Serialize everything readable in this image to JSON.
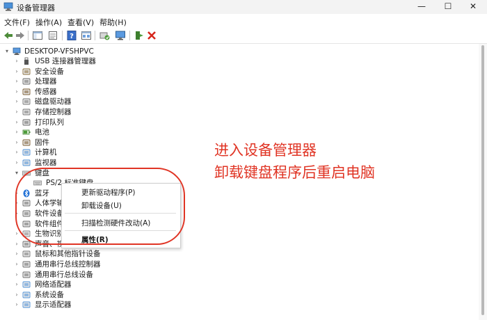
{
  "window": {
    "title": "设备管理器",
    "minimize": "—",
    "maximize": "☐",
    "close": "✕"
  },
  "menu": [
    "文件(F)",
    "操作(A)",
    "查看(V)",
    "帮助(H)"
  ],
  "toolbar_icons": [
    "back-arrow-icon",
    "forward-arrow-icon",
    "show-hide-console-tree-icon",
    "properties-icon",
    "help-icon",
    "view-icon",
    "update-driver-icon",
    "monitor-icon",
    "enable-device-icon",
    "uninstall-device-icon"
  ],
  "tree": {
    "root": "DESKTOP-VFSHPVC",
    "items": [
      {
        "label": "USB 连接器管理器",
        "icon": "usb-connector-icon"
      },
      {
        "label": "安全设备",
        "icon": "security-device-icon"
      },
      {
        "label": "处理器",
        "icon": "processor-icon"
      },
      {
        "label": "传感器",
        "icon": "sensor-icon"
      },
      {
        "label": "磁盘驱动器",
        "icon": "disk-drive-icon"
      },
      {
        "label": "存储控制器",
        "icon": "storage-controller-icon"
      },
      {
        "label": "打印队列",
        "icon": "print-queue-icon"
      },
      {
        "label": "电池",
        "icon": "battery-icon"
      },
      {
        "label": "固件",
        "icon": "firmware-icon"
      },
      {
        "label": "计算机",
        "icon": "computer-icon"
      },
      {
        "label": "监视器",
        "icon": "monitor-icon"
      },
      {
        "label": "键盘",
        "icon": "keyboard-icon"
      },
      {
        "label": "PS/2 标准键盘",
        "icon": "keyboard-icon"
      },
      {
        "label": "蓝牙",
        "icon": "bluetooth-icon"
      },
      {
        "label": "人体学输",
        "icon": "hid-icon"
      },
      {
        "label": "软件设备",
        "icon": "software-device-icon"
      },
      {
        "label": "软件组件",
        "icon": "software-component-icon"
      },
      {
        "label": "生物识别",
        "icon": "biometric-icon"
      },
      {
        "label": "声音、视",
        "icon": "audio-icon"
      },
      {
        "label": "鼠标和其他指针设备",
        "icon": "mouse-icon"
      },
      {
        "label": "通用串行总线控制器",
        "icon": "usb-controller-icon"
      },
      {
        "label": "通用串行总线设备",
        "icon": "usb-device-icon"
      },
      {
        "label": "网络适配器",
        "icon": "network-adapter-icon"
      },
      {
        "label": "系统设备",
        "icon": "system-device-icon"
      },
      {
        "label": "显示适配器",
        "icon": "display-adapter-icon"
      }
    ]
  },
  "context_menu": {
    "update_driver": "更新驱动程序(P)",
    "uninstall": "卸载设备(U)",
    "scan": "扫描检测硬件改动(A)",
    "properties": "属性(R)"
  },
  "annotation": {
    "line1": "进入设备管理器",
    "line2": "卸载键盘程序后重启电脑"
  },
  "colors": {
    "annotation": "#e03424",
    "titlebar": "#f3f3f3"
  }
}
